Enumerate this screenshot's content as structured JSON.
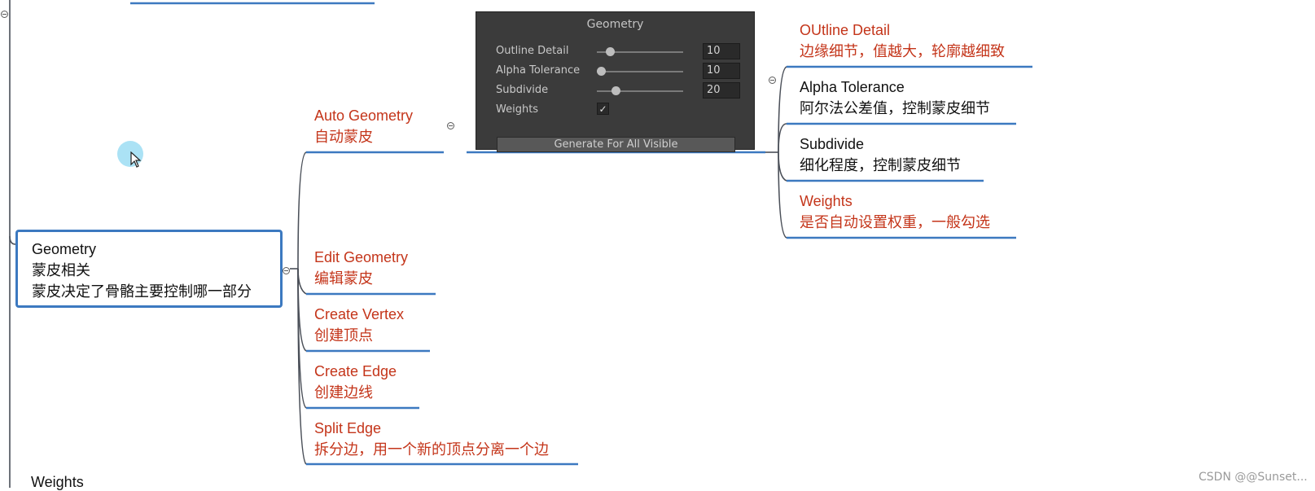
{
  "root": {
    "title": "Geometry",
    "line1": "蒙皮相关",
    "line2": "蒙皮决定了骨骼主要控制哪一部分"
  },
  "branches": [
    {
      "title": "Auto Geometry",
      "sub": "自动蒙皮"
    },
    {
      "title": "Edit Geometry",
      "sub": "编辑蒙皮"
    },
    {
      "title": "Create Vertex",
      "sub": "创建顶点"
    },
    {
      "title": "Create Edge",
      "sub": "创建边线"
    },
    {
      "title": "Split Edge",
      "sub": "拆分边，用一个新的顶点分离一个边"
    }
  ],
  "details": [
    {
      "title": "OUtline Detail",
      "sub": "边缘细节，值越大，轮廓越细致"
    },
    {
      "title": "Alpha Tolerance",
      "sub": "阿尔法公差值，控制蒙皮细节"
    },
    {
      "title": "Subdivide",
      "sub": "细化程度，控制蒙皮细节"
    },
    {
      "title": "Weights",
      "sub": "是否自动设置权重，一般勾选"
    }
  ],
  "panel": {
    "title": "Geometry",
    "rows": [
      {
        "label": "Outline Detail",
        "value": "10",
        "level": 0.15
      },
      {
        "label": "Alpha Tolerance",
        "value": "10",
        "level": 0.05
      },
      {
        "label": "Subdivide",
        "value": "20",
        "level": 0.22
      }
    ],
    "weights_label": "Weights",
    "weights_checked": "✓",
    "button": "Generate For All Visible"
  },
  "bottom_node": "Weights",
  "watermark": "CSDN @@Sunset...",
  "colors": {
    "accent_red": "#c4351a",
    "line_blue": "#3c79c0",
    "panel_bg": "#3b3b3b"
  }
}
